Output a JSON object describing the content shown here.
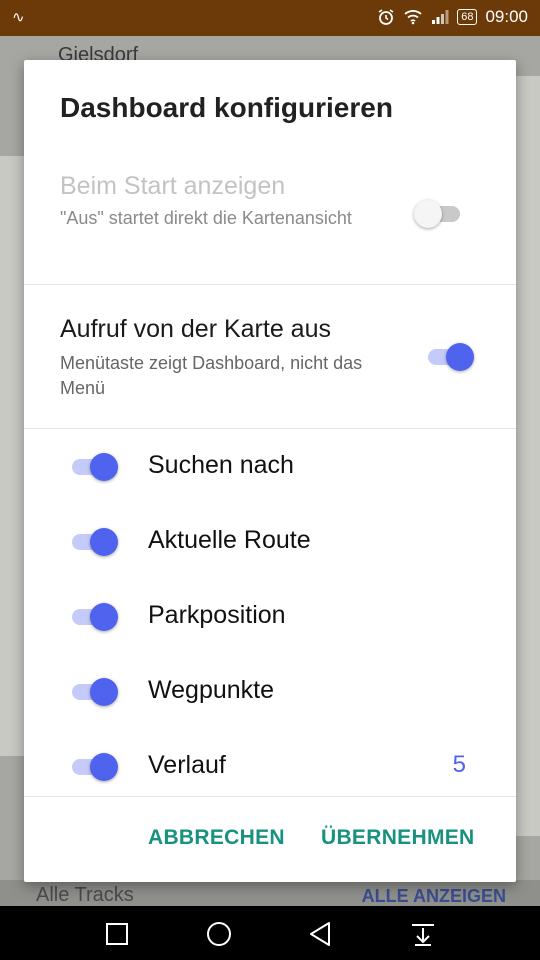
{
  "status_bar": {
    "left_icon": "signal-wave-icon",
    "battery": "68",
    "time": "09:00"
  },
  "map": {
    "place_label": "Gielsdorf",
    "bottom_left": "Alle Tracks",
    "bottom_right": "ALLE ANZEIGEN"
  },
  "dialog": {
    "title": "Dashboard konfigurieren",
    "pref_start": {
      "title": "Beim Start anzeigen",
      "summary": "\"Aus\" startet direkt die Kartenansicht",
      "enabled": false,
      "checked": false
    },
    "pref_map": {
      "title": "Aufruf von der Karte aus",
      "summary": "Menütaste zeigt Dashboard, nicht das Menü",
      "checked": true
    },
    "items": [
      {
        "label": "Suchen nach",
        "checked": true,
        "count": ""
      },
      {
        "label": "Aktuelle Route",
        "checked": true,
        "count": ""
      },
      {
        "label": "Parkposition",
        "checked": true,
        "count": ""
      },
      {
        "label": "Wegpunkte",
        "checked": true,
        "count": ""
      },
      {
        "label": "Verlauf",
        "checked": true,
        "count": "5"
      }
    ],
    "cancel_label": "ABBRECHEN",
    "apply_label": "ÜBERNEHMEN"
  },
  "colors": {
    "accent": "#4f63ee",
    "button_text": "#18917e",
    "status_bar": "#6b3a08"
  }
}
